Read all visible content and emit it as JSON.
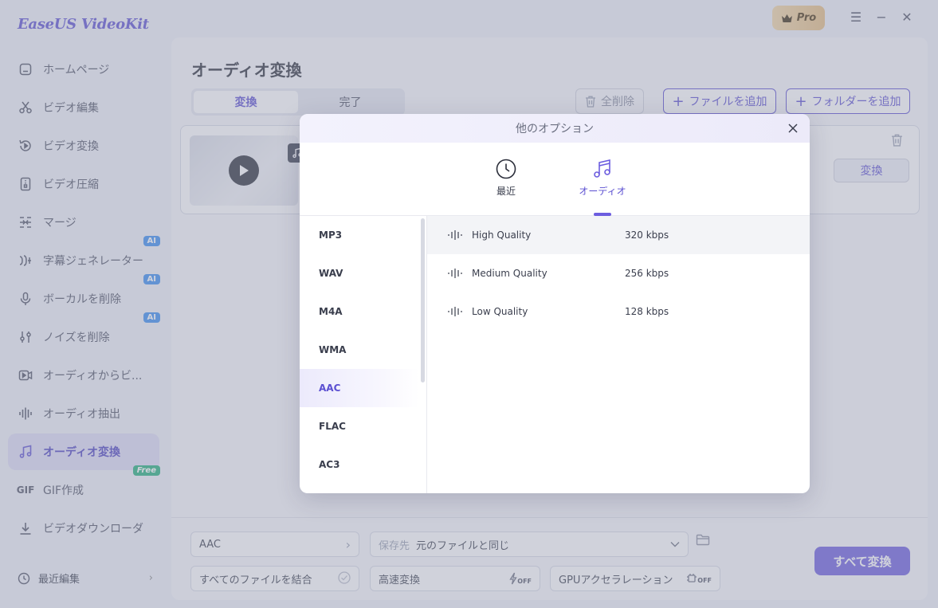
{
  "app": {
    "logo": "EaseUS VideoKit",
    "pro_label": "Pro",
    "menu_icon": "hamburger-icon",
    "minimize_icon": "minimize-icon",
    "close_icon": "close-icon"
  },
  "sidebar": {
    "items": [
      {
        "label": "ホームページ",
        "icon": "home-icon"
      },
      {
        "label": "ビデオ編集",
        "icon": "scissors-icon"
      },
      {
        "label": "ビデオ変換",
        "icon": "video-convert-icon"
      },
      {
        "label": "ビデオ圧縮",
        "icon": "compress-icon"
      },
      {
        "label": "マージ",
        "icon": "merge-icon"
      },
      {
        "label": "字幕ジェネレーター",
        "icon": "subtitle-icon",
        "badge": "AI"
      },
      {
        "label": "ボーカルを削除",
        "icon": "microphone-icon",
        "badge": "AI"
      },
      {
        "label": "ノイズを削除",
        "icon": "sliders-icon",
        "badge": "AI"
      },
      {
        "label": "オーディオからビ...",
        "icon": "audio-to-video-icon"
      },
      {
        "label": "オーディオ抽出",
        "icon": "waveform-icon"
      },
      {
        "label": "オーディオ変換",
        "icon": "music-note-icon",
        "active": true
      },
      {
        "label": "GIF作成",
        "icon": "gif-icon",
        "badge": "Free"
      },
      {
        "label": "ビデオダウンローダ",
        "icon": "download-icon"
      }
    ],
    "recent_edit": "最近編集"
  },
  "main": {
    "title": "オーディオ変換",
    "tabs": [
      {
        "label": "変換",
        "active": true
      },
      {
        "label": "完了"
      }
    ],
    "clear_all": "全削除",
    "add_file": "ファイルを追加",
    "add_folder": "フォルダーを追加",
    "card": {
      "convert_label": "変換"
    }
  },
  "bottom": {
    "format": "AAC",
    "save_label": "保存先",
    "save_value": "元のファイルと同じ",
    "merge_label": "すべてのファイルを結合",
    "fast_convert": "高速変換",
    "fast_state": "OFF",
    "gpu_label": "GPUアクセラレーション",
    "gpu_state": "OFF",
    "convert_all": "すべて変換"
  },
  "modal": {
    "title": "他のオプション",
    "tabs": [
      {
        "label": "最近",
        "icon": "clock-icon"
      },
      {
        "label": "オーディオ",
        "icon": "music-note-icon",
        "active": true
      }
    ],
    "formats": [
      "MP3",
      "WAV",
      "M4A",
      "WMA",
      "AAC",
      "FLAC",
      "AC3"
    ],
    "selected_format": "AAC",
    "qualities": [
      {
        "name": "High Quality",
        "bitrate": "320 kbps",
        "selected": true
      },
      {
        "name": "Medium Quality",
        "bitrate": "256 kbps"
      },
      {
        "name": "Low Quality",
        "bitrate": "128 kbps"
      }
    ]
  },
  "colors": {
    "accent": "#6c5ddf",
    "ai_badge": "#3a8df0",
    "free_badge": "#21b07a"
  }
}
